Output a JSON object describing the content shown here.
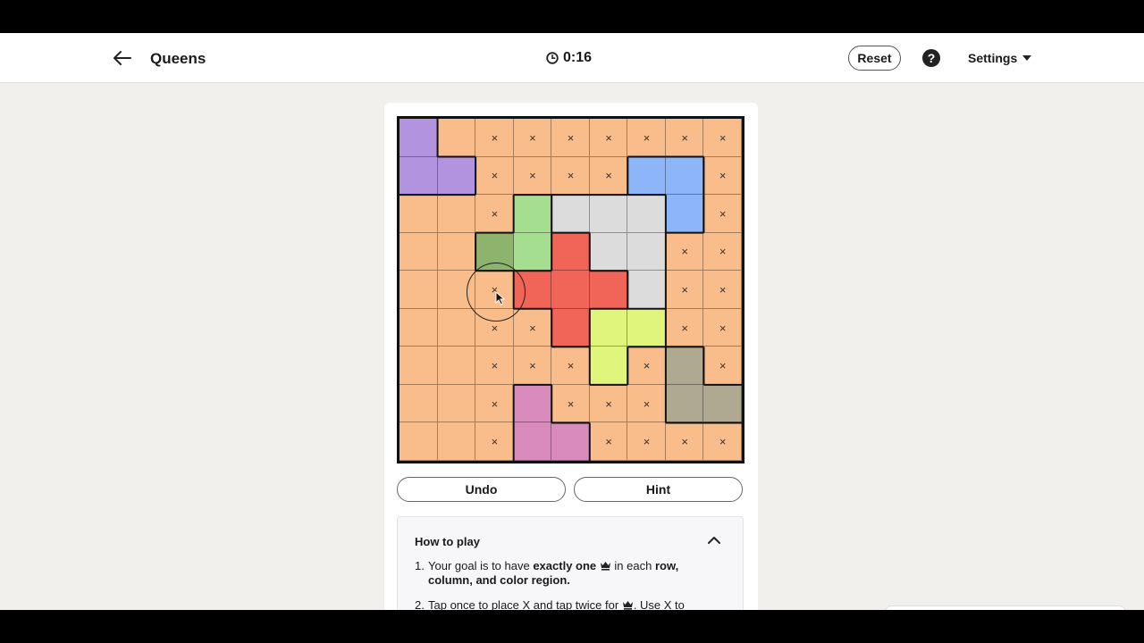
{
  "header": {
    "title": "Queens",
    "timer": "0:16",
    "reset_label": "Reset",
    "help_label": "?",
    "settings_label": "Settings"
  },
  "board": {
    "size": 9,
    "colors": {
      "O": "#f9bd8c",
      "P": "#b293e0",
      "B": "#8cb6f8",
      "G": "#a5de90",
      "D": "#8db36c",
      "W": "#dcdcdc",
      "R": "#f06557",
      "Y": "#e0f57c",
      "T": "#b0a992",
      "M": "#d98bbd"
    },
    "regions": [
      [
        "P",
        "O",
        "O",
        "O",
        "O",
        "O",
        "O",
        "O",
        "O"
      ],
      [
        "P",
        "P",
        "O",
        "O",
        "O",
        "O",
        "B",
        "B",
        "O"
      ],
      [
        "O",
        "O",
        "O",
        "G",
        "W",
        "W",
        "W",
        "B",
        "O"
      ],
      [
        "O",
        "O",
        "G",
        "G",
        "R",
        "W",
        "W",
        "O",
        "O"
      ],
      [
        "O",
        "O",
        "O",
        "R",
        "R",
        "R",
        "W",
        "O",
        "O"
      ],
      [
        "O",
        "O",
        "O",
        "O",
        "R",
        "Y",
        "Y",
        "O",
        "O"
      ],
      [
        "O",
        "O",
        "O",
        "O",
        "O",
        "Y",
        "O",
        "T",
        "O"
      ],
      [
        "O",
        "O",
        "O",
        "M",
        "O",
        "O",
        "O",
        "T",
        "T"
      ],
      [
        "O",
        "O",
        "O",
        "M",
        "M",
        "O",
        "O",
        "O",
        "O"
      ]
    ],
    "marks": [
      [
        0,
        0,
        1,
        1,
        1,
        1,
        1,
        1,
        1
      ],
      [
        0,
        0,
        1,
        1,
        1,
        1,
        0,
        0,
        1
      ],
      [
        0,
        0,
        1,
        0,
        0,
        0,
        0,
        0,
        1
      ],
      [
        0,
        0,
        0,
        0,
        0,
        0,
        0,
        1,
        1
      ],
      [
        0,
        0,
        1,
        0,
        0,
        0,
        0,
        1,
        1
      ],
      [
        0,
        0,
        1,
        1,
        0,
        0,
        0,
        1,
        1
      ],
      [
        0,
        0,
        1,
        1,
        1,
        0,
        1,
        0,
        1
      ],
      [
        0,
        0,
        1,
        0,
        1,
        1,
        1,
        0,
        0
      ],
      [
        0,
        0,
        1,
        0,
        0,
        1,
        1,
        1,
        1
      ]
    ],
    "mark_symbol": "×",
    "highlighted_cell": [
      3,
      2
    ]
  },
  "controls": {
    "undo_label": "Undo",
    "hint_label": "Hint"
  },
  "howto": {
    "title": "How to play",
    "rule1_num": "1.",
    "rule1_a": "Your goal is to have ",
    "rule1_b": "exactly one",
    "rule1_c": " in each ",
    "rule1_d": "row, column, and color region.",
    "rule2_num": "2.",
    "rule2_a": "Tap once to place X and tap twice for",
    "rule2_b": ". Use X to"
  }
}
